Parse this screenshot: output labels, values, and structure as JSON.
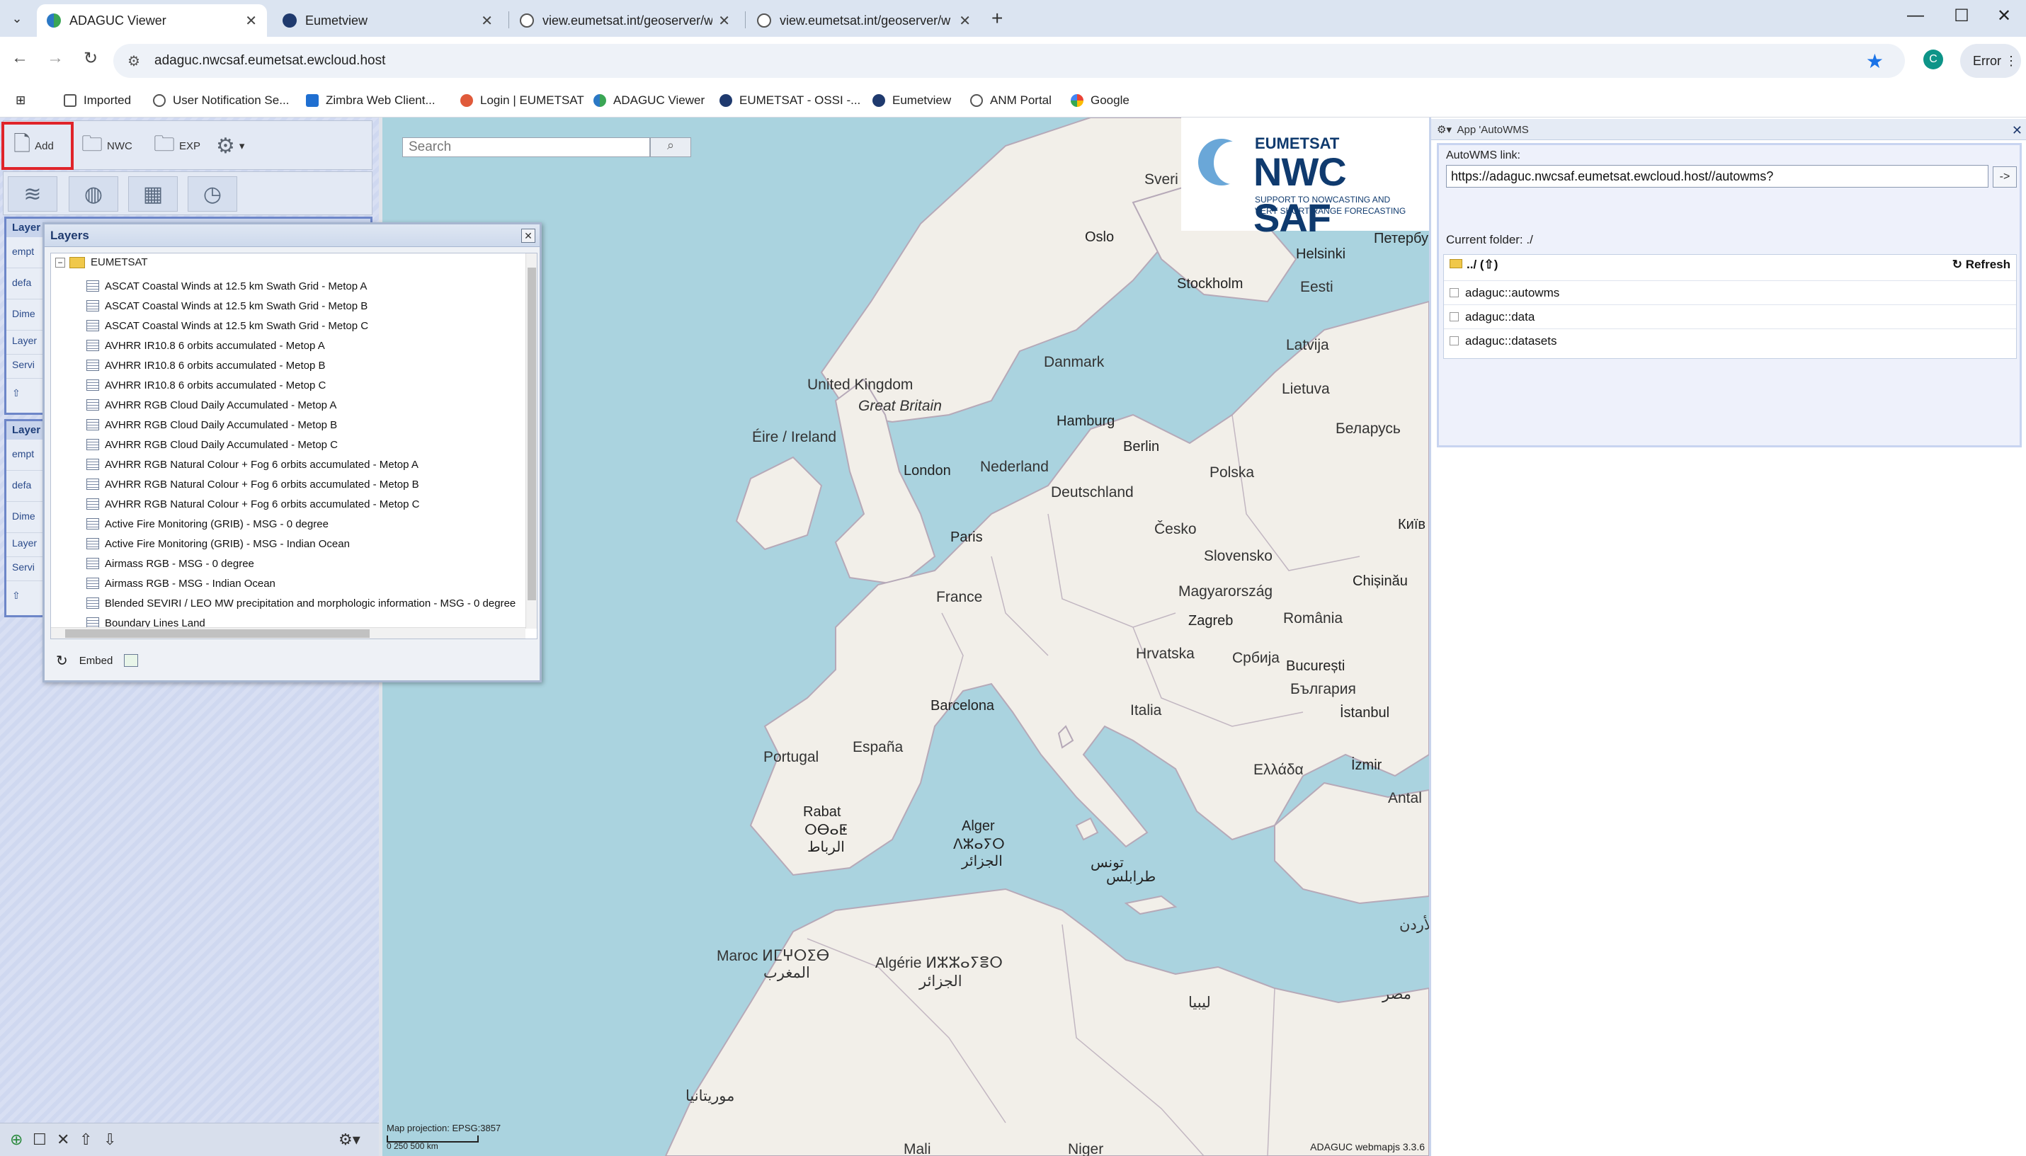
{
  "browser": {
    "tabs": [
      {
        "title": "ADAGUC Viewer",
        "active": true
      },
      {
        "title": "Eumetview",
        "active": false
      },
      {
        "title": "view.eumetsat.int/geoserver/w",
        "active": false
      },
      {
        "title": "view.eumetsat.int/geoserver/w",
        "active": false
      }
    ],
    "new_tab": "+",
    "url": "adaguc.nwcsaf.eumetsat.ewcloud.host",
    "profile_initial": "C",
    "error_label": "Error",
    "bookmarks": [
      "Imported",
      "User Notification Se...",
      "Zimbra Web Client...",
      "Login | EUMETSAT",
      "ADAGUC Viewer",
      "EUMETSAT - OSSI -...",
      "Eumetview",
      "ANM Portal",
      "Google"
    ]
  },
  "toolbar": {
    "add_label": "Add",
    "nwc_label": "NWC",
    "exp_label": "EXP"
  },
  "left": {
    "block1_title": "Layer",
    "block1_rows": [
      "empt",
      "defa",
      "Dime",
      "Layer",
      "Servi"
    ],
    "block2_title": "Layer",
    "block2_rows": [
      "empt",
      "defa",
      "Dime",
      "Layer",
      "Servi"
    ]
  },
  "map": {
    "search_placeholder": "Search",
    "logo_top": "EUMETSAT",
    "logo_main": "NWC SAF",
    "logo_sub1": "SUPPORT TO NOWCASTING AND",
    "logo_sub2": "VERY SHORT RANGE FORECASTING",
    "projection": "Map projection: EPSG:3857",
    "scale_label": "0    250    500       km",
    "version": "ADAGUC webmapjs 3.3.6",
    "labels": {
      "uk": "United Kingdom",
      "gb": "Great Britain",
      "ireland": "Éire / Ireland",
      "london": "London",
      "paris": "Paris",
      "france": "France",
      "espana": "España",
      "portugal": "Portugal",
      "barcelona": "Barcelona",
      "nederland": "Nederland",
      "deutschland": "Deutschland",
      "berlin": "Berlin",
      "hamburg": "Hamburg",
      "danmark": "Danmark",
      "polska": "Polska",
      "cesko": "Česko",
      "slovensko": "Slovensko",
      "magyarorszag": "Magyarország",
      "romania": "România",
      "bucuresti": "București",
      "italia": "Italia",
      "zagreb": "Zagreb",
      "hrvatska": "Hrvatska",
      "srbija": "Србија",
      "bulgaria": "България",
      "istanbul": "İstanbul",
      "izmir": "İzmir",
      "ellada": "Ελλάδα",
      "antal": "Antal",
      "oslo": "Oslo",
      "stockholm": "Stockholm",
      "helsinki": "Helsinki",
      "eesti": "Eesti",
      "latvija": "Latvija",
      "lietuva": "Lietuva",
      "belarus": "Беларусь",
      "kyiv": "Київ",
      "chisinau": "Chișinău",
      "petersburg": "Петербу",
      "sveri": "Sveri",
      "alger": "Alger",
      "alger_tif": "ⴷⵣⴰⵢⵔ",
      "alger_ar": "الجزائر",
      "tunis": "تونس",
      "tarabulus": "طرابلس",
      "rabat": "Rabat",
      "rabat_tif": "ⵔⴱⴰⵟ",
      "rabat_ar": "الرباط",
      "maroc": "Maroc ⵍⵎⵖⵔⵉⴱ",
      "maroc_ar": "المغرب",
      "algerie": "Algérie ⵍⵣⵣⴰⵢⴻⵔ",
      "algerie_ar": "الجزائر",
      "libya": "ليبيا",
      "misr": "مصر",
      "mauritania": "موريتانيا",
      "mali": "Mali",
      "niger": "Niger",
      "urdun": "الأردن"
    }
  },
  "layers_dialog": {
    "title": "Layers",
    "root": "EUMETSAT",
    "items": [
      "ASCAT Coastal Winds at 12.5 km Swath Grid - Metop A",
      "ASCAT Coastal Winds at 12.5 km Swath Grid - Metop B",
      "ASCAT Coastal Winds at 12.5 km Swath Grid - Metop C",
      "AVHRR IR10.8 6 orbits accumulated - Metop A",
      "AVHRR IR10.8 6 orbits accumulated - Metop B",
      "AVHRR IR10.8 6 orbits accumulated - Metop C",
      "AVHRR RGB Cloud Daily Accumulated - Metop A",
      "AVHRR RGB Cloud Daily Accumulated - Metop B",
      "AVHRR RGB Cloud Daily Accumulated - Metop C",
      "AVHRR RGB Natural Colour + Fog 6 orbits accumulated - Metop A",
      "AVHRR RGB Natural Colour + Fog 6 orbits accumulated - Metop B",
      "AVHRR RGB Natural Colour + Fog 6 orbits accumulated - Metop C",
      "Active Fire Monitoring (GRIB) - MSG - 0 degree",
      "Active Fire Monitoring (GRIB) - MSG - Indian Ocean",
      "Airmass RGB - MSG - 0 degree",
      "Airmass RGB - MSG - Indian Ocean",
      "Blended SEVIRI / LEO MW precipitation and morphologic information - MSG - 0 degree",
      "Boundary Lines Land"
    ],
    "embed_label": "Embed"
  },
  "autowms": {
    "title": "App 'AutoWMS",
    "link_label": "AutoWMS link:",
    "link_value": "https://adaguc.nwcsaf.eumetsat.ewcloud.host//autowms?",
    "go_label": "->",
    "current_folder": "Current folder: ./",
    "up_label": "../ (⇧)",
    "refresh_label": "Refresh",
    "entries": [
      "adaguc::autowms",
      "adaguc::data",
      "adaguc::datasets"
    ]
  },
  "colors": {
    "highlight": "#e0242a",
    "sea": "#aad3df",
    "land": "#f2efe9",
    "accent": "#1a73e8"
  }
}
